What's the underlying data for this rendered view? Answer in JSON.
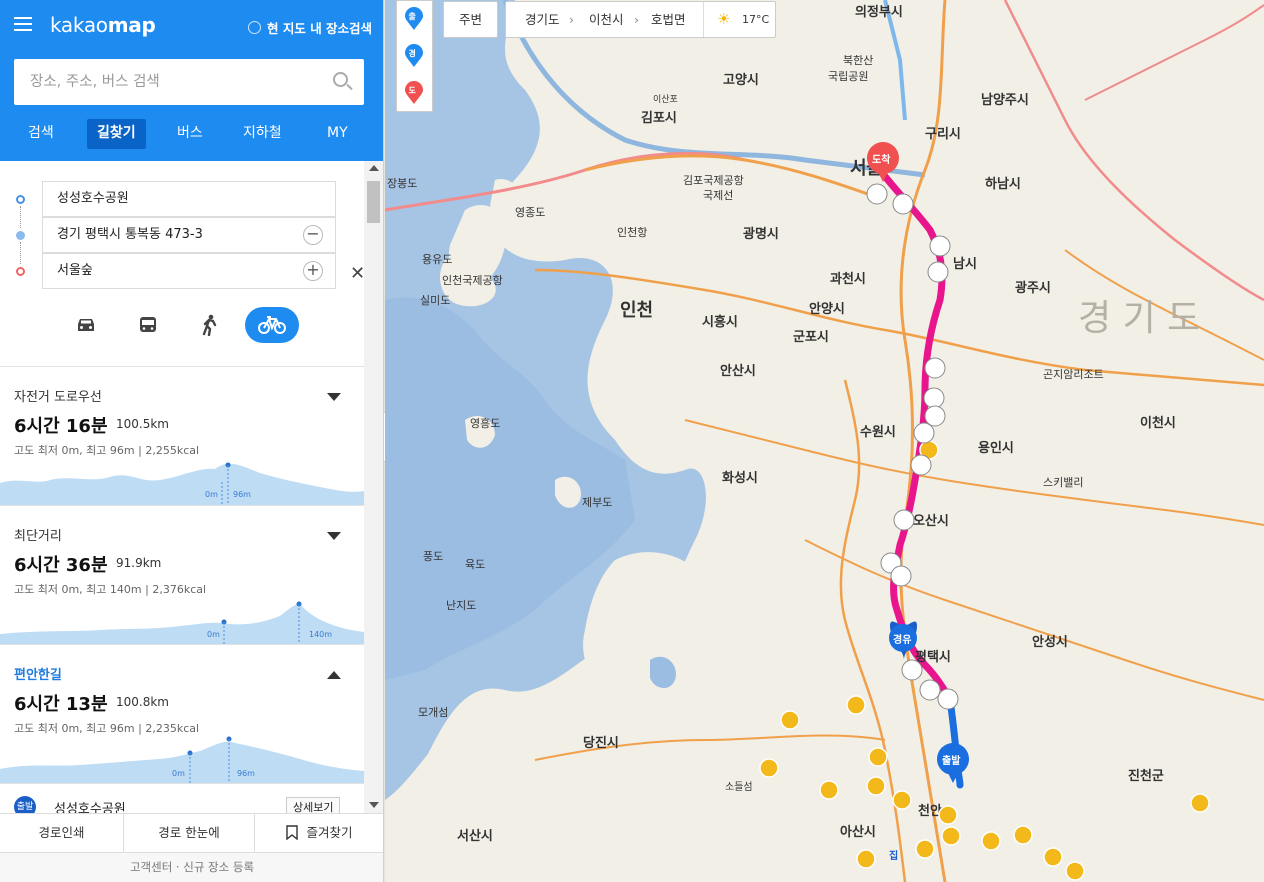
{
  "app": {
    "brand_light": "kakao",
    "brand_bold": "map",
    "map_only_label": "현 지도 내 장소검색"
  },
  "search": {
    "placeholder": "장소, 주소, 버스 검색"
  },
  "tabs": [
    "검색",
    "길찾기",
    "버스",
    "지하철",
    "MY"
  ],
  "route": {
    "origin": "성성호수공원",
    "waypoint": "경기 평택시 통복동 473-3",
    "destination": "서울숲",
    "modes": [
      "car-icon",
      "bus-icon",
      "walk-icon",
      "bike-icon"
    ],
    "active_mode": "bike"
  },
  "results": [
    {
      "title": "자전거 도로우선",
      "time": "6시간 16분",
      "distance": "100.5km",
      "meta": "고도 최저 0m, 최고 96m",
      "kcal": "2,255kcal",
      "min_label": "0m",
      "max_label": "96m",
      "expanded": false
    },
    {
      "title": "최단거리",
      "time": "6시간 36분",
      "distance": "91.9km",
      "meta": "고도 최저 0m, 최고 140m",
      "kcal": "2,376kcal",
      "min_label": "0m",
      "max_label": "140m",
      "expanded": false
    },
    {
      "title": "편안한길",
      "time": "6시간 13분",
      "distance": "100.8km",
      "meta": "고도 최저 0m, 최고 96m",
      "kcal": "2,235kcal",
      "min_label": "0m",
      "max_label": "96m",
      "expanded": true
    }
  ],
  "start_row": {
    "badge": "출발",
    "name": "성성호수공원",
    "detail": "상세보기"
  },
  "bottom_tabs": [
    "경로인쇄",
    "경로 한눈에",
    "즐겨찾기"
  ],
  "footer": {
    "text": "고객센터 · 신규 장소 등록"
  },
  "map_toolbar": {
    "nearby": "주변",
    "breadcrumb": [
      "경기도",
      "이천시",
      "호법면"
    ],
    "weather": "17°C",
    "pins": [
      "출",
      "경",
      "도"
    ]
  },
  "map_markers": {
    "arrive": "도착",
    "via": "경유",
    "depart": "출발"
  },
  "map_labels": [
    "의정부시",
    "고양시",
    "북한산",
    "국립공원",
    "남양주시",
    "김포시",
    "이산포",
    "구리시",
    "서울",
    "하남시",
    "김포국제공항",
    "국제선",
    "영종도",
    "장봉도",
    "광명시",
    "인천항",
    "용유도",
    "인천국제공항",
    "실미도",
    "과천시",
    "남시",
    "광주시",
    "인천",
    "시흥시",
    "안양시",
    "군포시",
    "경 기 도",
    "안산시",
    "수원시",
    "용인시",
    "이천시",
    "영흥도",
    "화성시",
    "제부도",
    "스키밸리",
    "곤지암리조트",
    "오산시",
    "안성시",
    "풍도",
    "육도",
    "난지도",
    "평택시",
    "모개섬",
    "당진시",
    "진천군",
    "서산시",
    "아산시",
    "천안",
    "소들섬",
    "집"
  ],
  "colors": {
    "primary": "#1e8bf0",
    "route": "#e8158c",
    "route_blue": "#1a6ee0",
    "water": "#9fbfe0",
    "land": "#f2efe6"
  }
}
